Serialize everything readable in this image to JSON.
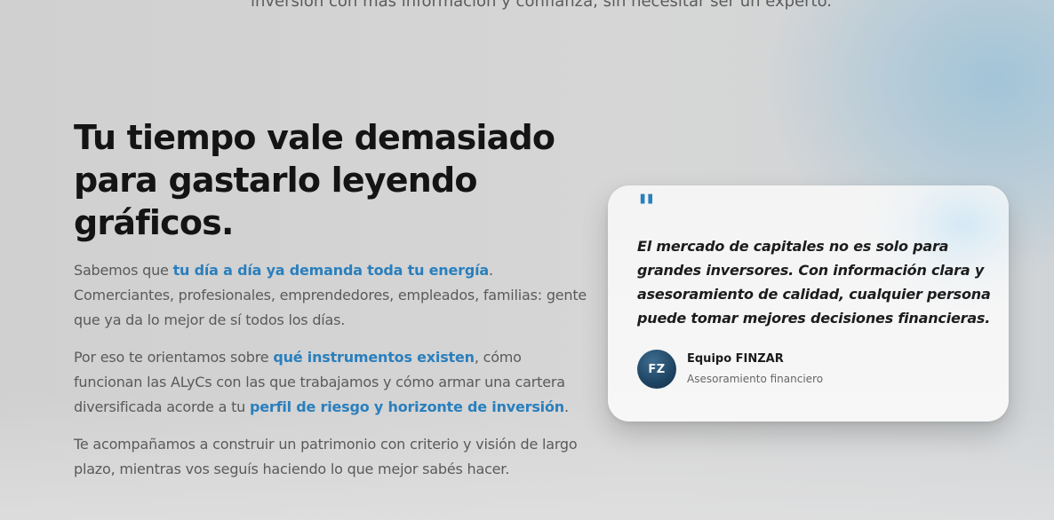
{
  "intro": {
    "top_line": "inversión con más información y confianza, sin necesitar ser un experto."
  },
  "section": {
    "headline": "Tu tiempo vale demasiado para gastarlo leyendo gráficos.",
    "p1": {
      "a": "Sabemos que ",
      "hl1": "tu día a día ya demanda toda tu energía",
      "b": ". Comerciantes, profesionales, emprendedores, empleados, familias: gente que ya da lo mejor de sí todos los días."
    },
    "p2": {
      "a": "Por eso te orientamos sobre ",
      "hl1": "qué instrumentos existen",
      "b": ", cómo funcionan las ALyCs con las que trabajamos y cómo armar una cartera diversificada acorde a tu ",
      "hl2": "perfil de riesgo y horizonte de inversión",
      "c": "."
    },
    "p3": {
      "a": "Te acompañamos a construir un patrimonio con criterio y visión de largo plazo, mientras vos seguís haciendo lo que mejor sabés hacer."
    }
  },
  "testimonial": {
    "quote_mark": "\"",
    "text": "El mercado de capitales no es solo para grandes inversores. Con información clara y asesoramiento de calidad, cualquier persona puede tomar mejores decisiones financieras.",
    "avatar_initials": "FZ",
    "author_name": "Equipo FINZAR",
    "author_role": "Asesoramiento financiero"
  },
  "colors": {
    "accent": "#2a7fbd",
    "heading": "#141414",
    "body_text": "#5a5a5a",
    "avatar_bg": "#1f4463"
  }
}
